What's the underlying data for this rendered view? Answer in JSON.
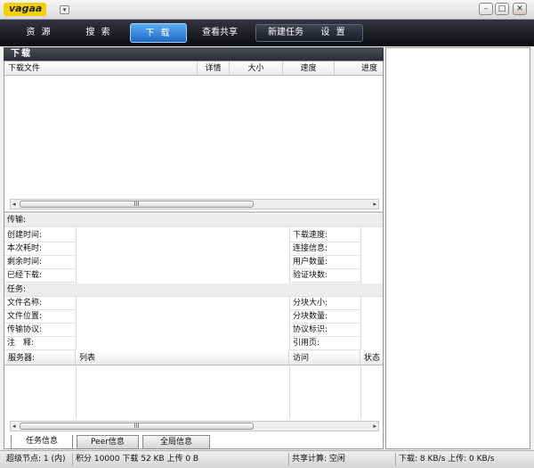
{
  "app": {
    "logo": "vagaa",
    "menu_glyph": "▾"
  },
  "window": {
    "minimize": "–",
    "maximize": "□",
    "close": "✕"
  },
  "nav": {
    "resources": "资 源",
    "search": "搜 索",
    "download": "下 载",
    "shares": "查看共享",
    "new_task": "新建任务",
    "settings": "设 置"
  },
  "section": {
    "title": "下载"
  },
  "download_table": {
    "columns": [
      "下载文件",
      "详情",
      "大小",
      "速度",
      "进度"
    ]
  },
  "scroll": {
    "thumb": "III",
    "left": "◂",
    "right": "▸"
  },
  "transfer": {
    "header": "传输:",
    "left_labels": [
      "创建时间:",
      "本次耗时:",
      "剩余时间:",
      "已经下载:"
    ],
    "right_labels": [
      "下载速度:",
      "连接信息:",
      "用户数量:",
      "验证块数:"
    ]
  },
  "task": {
    "header": "任务:",
    "left_labels": [
      "文件名称:",
      "文件位置:",
      "传输协议:",
      "注　释:"
    ],
    "right_labels": [
      "分块大小:",
      "分块数量:",
      "协议标识:",
      "引用页:"
    ]
  },
  "servers": {
    "columns": [
      "服务器:",
      "列表",
      "访问",
      "状态"
    ]
  },
  "tabs": [
    "任务信息",
    "Peer信息",
    "全局信息"
  ],
  "status": {
    "nodes": "超级节点: 1 (内)",
    "points": "积分 10000 下载 52 KB 上传 0 B",
    "share": "共享计算: 空闲",
    "speed": "下载: 8 KB/s  上传: 0 KB/s"
  },
  "colors": {
    "accent": "#1e64c0",
    "nav_bg": "#0c0d12"
  }
}
